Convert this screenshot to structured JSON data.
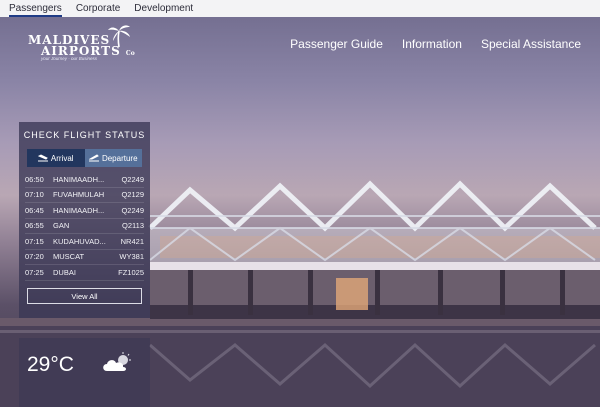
{
  "topbar": {
    "links": [
      "Passengers",
      "Corporate",
      "Development"
    ]
  },
  "logo": {
    "line1": "MALDIVES",
    "line2": "AIRPORTS",
    "suffix": "Co",
    "tagline": "your Journey · our Business"
  },
  "nav": {
    "items": [
      "Passenger Guide",
      "Information",
      "Special Assistance"
    ]
  },
  "flight_status": {
    "title": "CHECK FLIGHT STATUS",
    "tabs": {
      "arrival": "Arrival",
      "departure": "Departure"
    },
    "flights": [
      {
        "time": "06:50",
        "city": "HANIMAADH...",
        "code": "Q2249"
      },
      {
        "time": "07:10",
        "city": "FUVAHMULAH",
        "code": "Q2129"
      },
      {
        "time": "06:45",
        "city": "HANIMAADH...",
        "code": "Q2249"
      },
      {
        "time": "06:55",
        "city": "GAN",
        "code": "Q2113"
      },
      {
        "time": "07:15",
        "city": "KUDAHUVAD...",
        "code": "NR421"
      },
      {
        "time": "07:20",
        "city": "MUSCAT",
        "code": "WY381"
      },
      {
        "time": "07:25",
        "city": "DUBAI",
        "code": "FZ1025"
      }
    ],
    "view_all": "View All"
  },
  "weather": {
    "temperature": "29°C",
    "icon": "partly-cloudy-icon"
  },
  "colors": {
    "tab_arrival": "#22365e",
    "tab_departure": "#55709a",
    "topbar_active_underline": "#1f3b86"
  }
}
